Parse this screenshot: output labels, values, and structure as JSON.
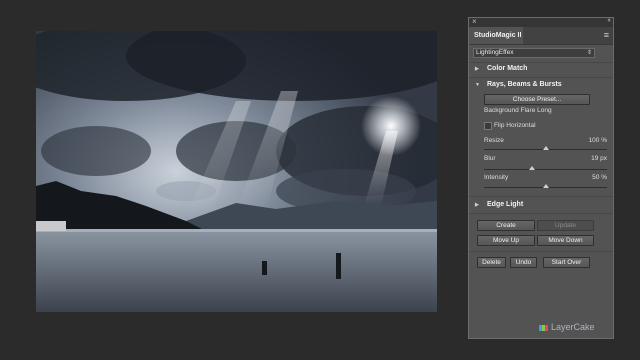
{
  "panel": {
    "close_glyph": "×",
    "collapse_glyph": "‹‹",
    "tab_title": "StudioMagic II",
    "menu_icon": "hamburger-icon",
    "preset_value": "LightingEffex",
    "sections": {
      "color_match": "Color Match",
      "rays": "Rays, Beams & Bursts",
      "edge_light": "Edge Light"
    },
    "choose_preset": "Choose Preset...",
    "preset_name": "Background Flare Long",
    "flip_horizontal": "Flip Horizontal",
    "sliders": [
      {
        "label": "Resize",
        "value_text": "100 %",
        "level": 0.5
      },
      {
        "label": "Blur",
        "value_text": "19 px",
        "level": 0.4
      },
      {
        "label": "Intensity",
        "value_text": "50 %",
        "level": 0.5
      }
    ],
    "buttons": {
      "create": "Create",
      "update": "Update",
      "move_up": "Move Up",
      "move_down": "Move Down",
      "delete": "Delete",
      "undo": "Undo",
      "start_over": "Start Over"
    },
    "logo_text": "LayerCake"
  },
  "colors": {
    "background": "#2b2b2b",
    "panel": "#535353",
    "sky": "#3b4452"
  }
}
